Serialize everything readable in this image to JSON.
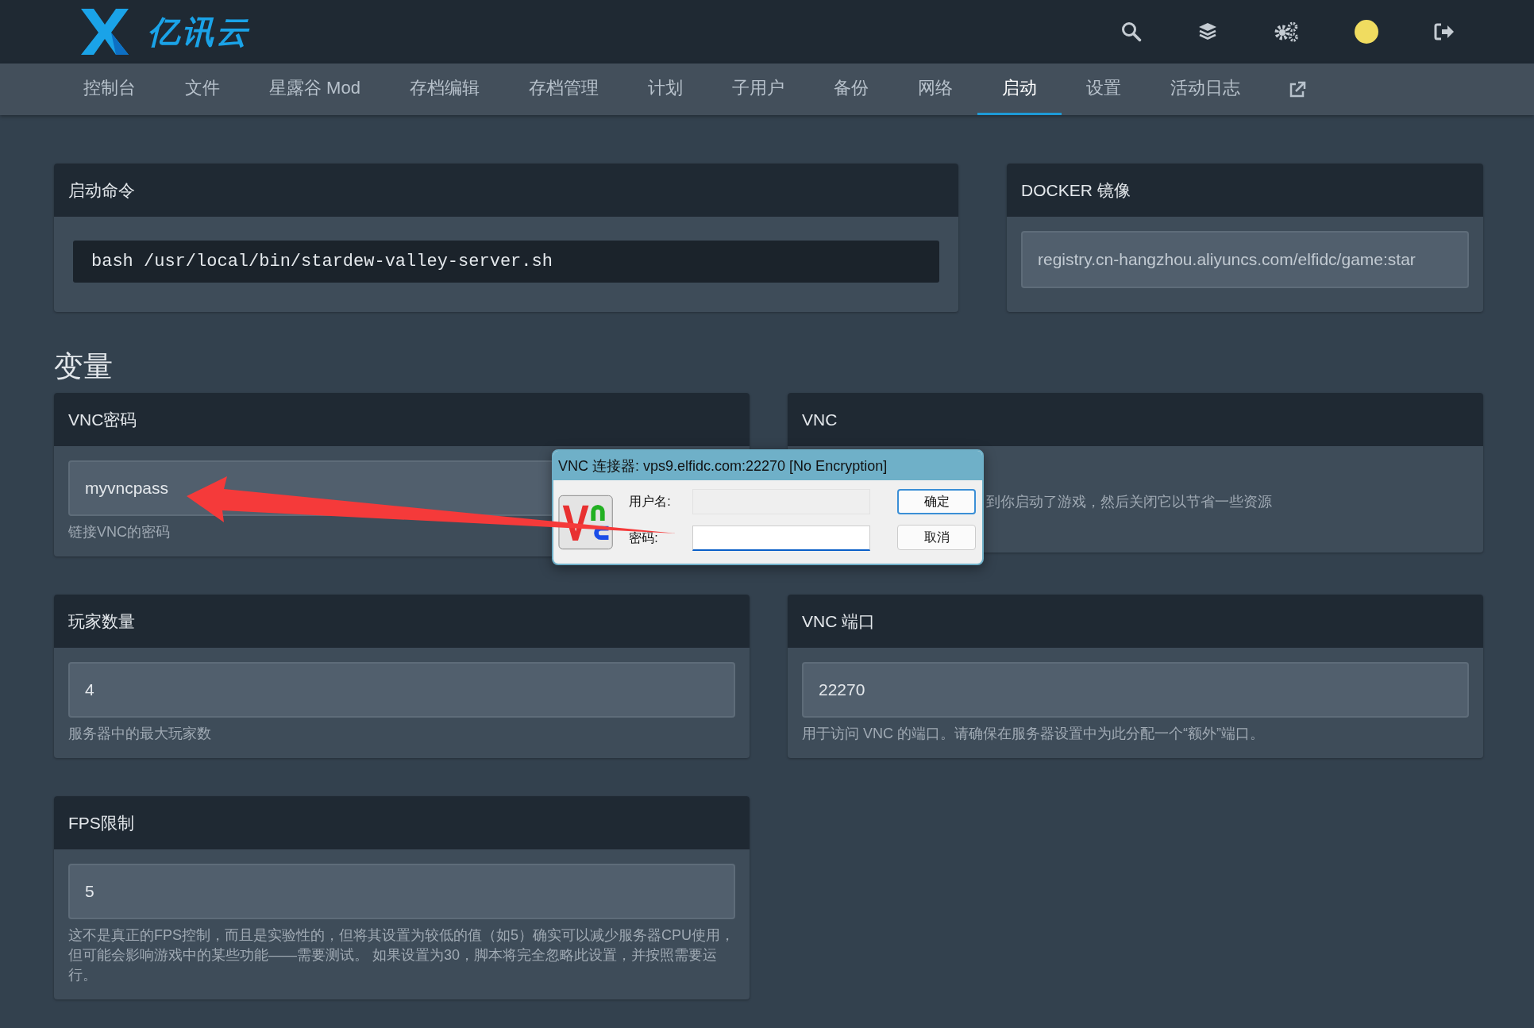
{
  "header": {
    "logo_text": "亿讯云"
  },
  "nav": {
    "tabs": [
      {
        "label": "控制台",
        "selected": false
      },
      {
        "label": "文件",
        "selected": false
      },
      {
        "label": "星露谷 Mod",
        "selected": false
      },
      {
        "label": "存档编辑",
        "selected": false
      },
      {
        "label": "存档管理",
        "selected": false
      },
      {
        "label": "计划",
        "selected": false
      },
      {
        "label": "子用户",
        "selected": false
      },
      {
        "label": "备份",
        "selected": false
      },
      {
        "label": "网络",
        "selected": false
      },
      {
        "label": "启动",
        "selected": true
      },
      {
        "label": "设置",
        "selected": false
      },
      {
        "label": "活动日志",
        "selected": false
      }
    ]
  },
  "startup": {
    "title": "启动命令",
    "command": "bash /usr/local/bin/stardew-valley-server.sh"
  },
  "docker": {
    "title": "DOCKER 镜像",
    "value": "registry.cn-hangzhou.aliyuncs.com/elfidc/game:star"
  },
  "variables": {
    "heading": "变量",
    "cards": [
      {
        "title": "VNC密码",
        "value": "myvncpass",
        "description": "链接VNC的密码"
      },
      {
        "title": "VNC",
        "description": "到你启动了游戏，然后关闭它以节省一些资源"
      },
      {
        "title": "玩家数量",
        "value": "4",
        "description": "服务器中的最大玩家数"
      },
      {
        "title": "VNC 端口",
        "value": "22270",
        "description": "用于访问 VNC 的端口。请确保在服务器设置中为此分配一个“额外”端口。"
      },
      {
        "title": "FPS限制",
        "value": "5",
        "description": "这不是真正的FPS控制，而且是实验性的，但将其设置为较低的值（如5）确实可以减少服务器CPU使用，但可能会影响游戏中的某些功能——需要测试。 如果设置为30，脚本将完全忽略此设置，并按照需要运行。"
      }
    ]
  },
  "dialog": {
    "title": "VNC 连接器: vps9.elfidc.com:22270 [No Encryption]",
    "fields": [
      {
        "label": "用户名:",
        "disabled": true,
        "focused": false
      },
      {
        "label": "密码:",
        "disabled": false,
        "focused": true
      }
    ],
    "buttons": [
      {
        "label": "确定",
        "default": true
      },
      {
        "label": "取消",
        "default": false
      }
    ]
  }
}
